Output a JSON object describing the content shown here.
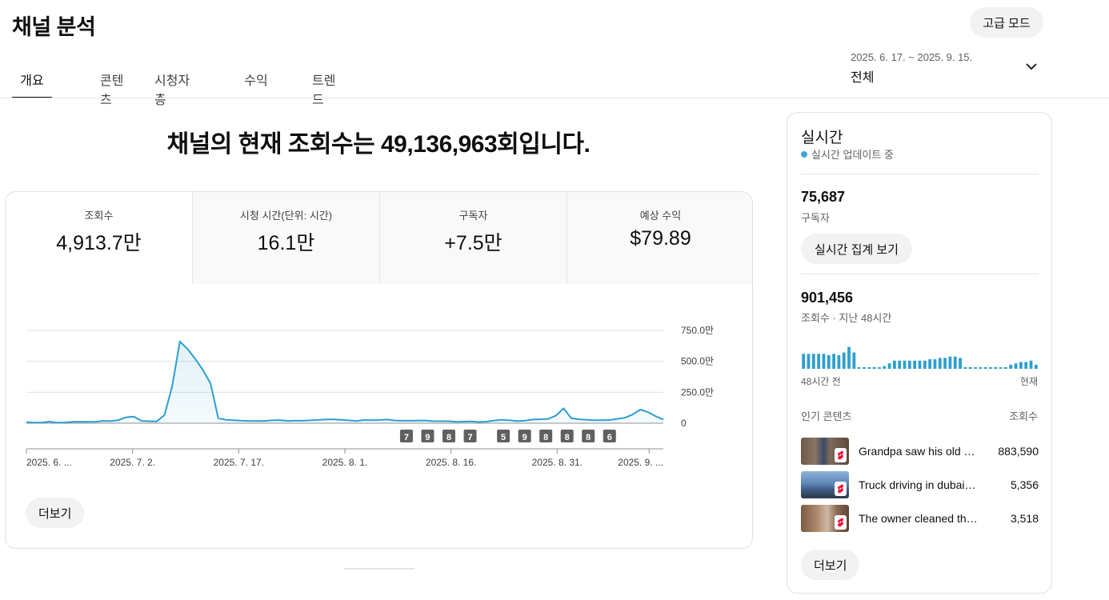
{
  "header": {
    "title": "채널 분석",
    "advanced_mode_label": "고급 모드"
  },
  "tabs": [
    {
      "label": "개요",
      "active": true
    },
    {
      "label": "콘텐츠",
      "active": false
    },
    {
      "label": "시청자층",
      "active": false
    },
    {
      "label": "수익",
      "active": false
    },
    {
      "label": "트렌드",
      "active": false
    }
  ],
  "date_picker": {
    "range": "2025. 6. 17. ~ 2025. 9. 15.",
    "scope": "전체",
    "icon": "chevron-down-icon"
  },
  "headline": "채널의 현재 조회수는 49,136,963회입니다.",
  "metrics": [
    {
      "label": "조회수",
      "value": "4,913.7만",
      "selected": true
    },
    {
      "label": "시청 시간(단위: 시간)",
      "value": "16.1만",
      "selected": false
    },
    {
      "label": "구독자",
      "value": "+7.5만",
      "selected": false
    },
    {
      "label": "예상 수익",
      "value": "$79.89",
      "selected": false
    }
  ],
  "chart_data": {
    "type": "area",
    "y_tick_labels": [
      "750.0만",
      "500.0만",
      "250.0만",
      "0"
    ],
    "y_tick_values": [
      7500000,
      5000000,
      2500000,
      0
    ],
    "ylim": [
      0,
      7500000
    ],
    "x_tick_labels": [
      "2025. 6. ...",
      "2025. 7. 2.",
      "2025. 7. 17.",
      "2025. 8. 1.",
      "2025. 8. 16.",
      "2025. 8. 31.",
      "2025. 9. ..."
    ],
    "x_tick_days": [
      0,
      15,
      30,
      45,
      60,
      75,
      88
    ],
    "x_days_total": 90,
    "series": [
      {
        "values": [
          80000,
          50000,
          50000,
          130000,
          40000,
          60000,
          110000,
          120000,
          110000,
          120000,
          190000,
          170000,
          250000,
          480000,
          530000,
          190000,
          160000,
          150000,
          650000,
          3000000,
          6600000,
          6000000,
          5200000,
          4300000,
          3200000,
          400000,
          280000,
          240000,
          200000,
          190000,
          180000,
          180000,
          230000,
          250000,
          190000,
          200000,
          200000,
          230000,
          260000,
          310000,
          320000,
          280000,
          230000,
          180000,
          260000,
          240000,
          260000,
          300000,
          220000,
          200000,
          200000,
          210000,
          220000,
          170000,
          160000,
          160000,
          110000,
          130000,
          140000,
          100000,
          130000,
          220000,
          270000,
          230000,
          170000,
          210000,
          300000,
          320000,
          350000,
          610000,
          1200000,
          410000,
          320000,
          280000,
          240000,
          240000,
          260000,
          350000,
          440000,
          700000,
          1100000,
          900000,
          560000,
          300000
        ],
        "color": "#2e9fcf"
      }
    ],
    "markers": [
      {
        "label": "7",
        "day": 53.7
      },
      {
        "label": "9",
        "day": 56.7
      },
      {
        "label": "8",
        "day": 59.7
      },
      {
        "label": "7",
        "day": 62.7
      },
      {
        "label": "5",
        "day": 67.4
      },
      {
        "label": "9",
        "day": 70.4
      },
      {
        "label": "8",
        "day": 73.4
      },
      {
        "label": "8",
        "day": 76.4
      },
      {
        "label": "8",
        "day": 79.4
      },
      {
        "label": "6",
        "day": 82.4
      }
    ],
    "grid": true
  },
  "main_more_label": "더보기",
  "realtime": {
    "title": "실시간",
    "status": "실시간 업데이트 중",
    "subscribers": "75,687",
    "subscribers_label": "구독자",
    "realtime_button": "실시간 집계 보기",
    "views_48h": "901,456",
    "views_48h_label": "조회수 · 지난 48시간",
    "hourly_views": [
      0.55,
      0.55,
      0.55,
      0.55,
      0.55,
      0.5,
      0.55,
      0.5,
      0.6,
      0.8,
      0.6,
      0.05,
      0.05,
      0.05,
      0.05,
      0.05,
      0.1,
      0.2,
      0.3,
      0.3,
      0.3,
      0.3,
      0.3,
      0.3,
      0.3,
      0.35,
      0.35,
      0.4,
      0.4,
      0.45,
      0.45,
      0.4,
      0.05,
      0.05,
      0.05,
      0.05,
      0.05,
      0.05,
      0.05,
      0.05,
      0.05,
      0.15,
      0.2,
      0.25,
      0.25,
      0.3,
      0.15
    ],
    "axis_start": "48시간 전",
    "axis_end": "현재",
    "top_content_header": "인기 콘텐츠",
    "top_content_metric": "조회수",
    "top_content": [
      {
        "title": "Grandpa saw his old h...",
        "views": "883,590"
      },
      {
        "title": "Truck driving in dubai. #s...",
        "views": "5,356"
      },
      {
        "title": "The owner cleaned the h...",
        "views": "3,518"
      }
    ],
    "more_label": "더보기"
  }
}
